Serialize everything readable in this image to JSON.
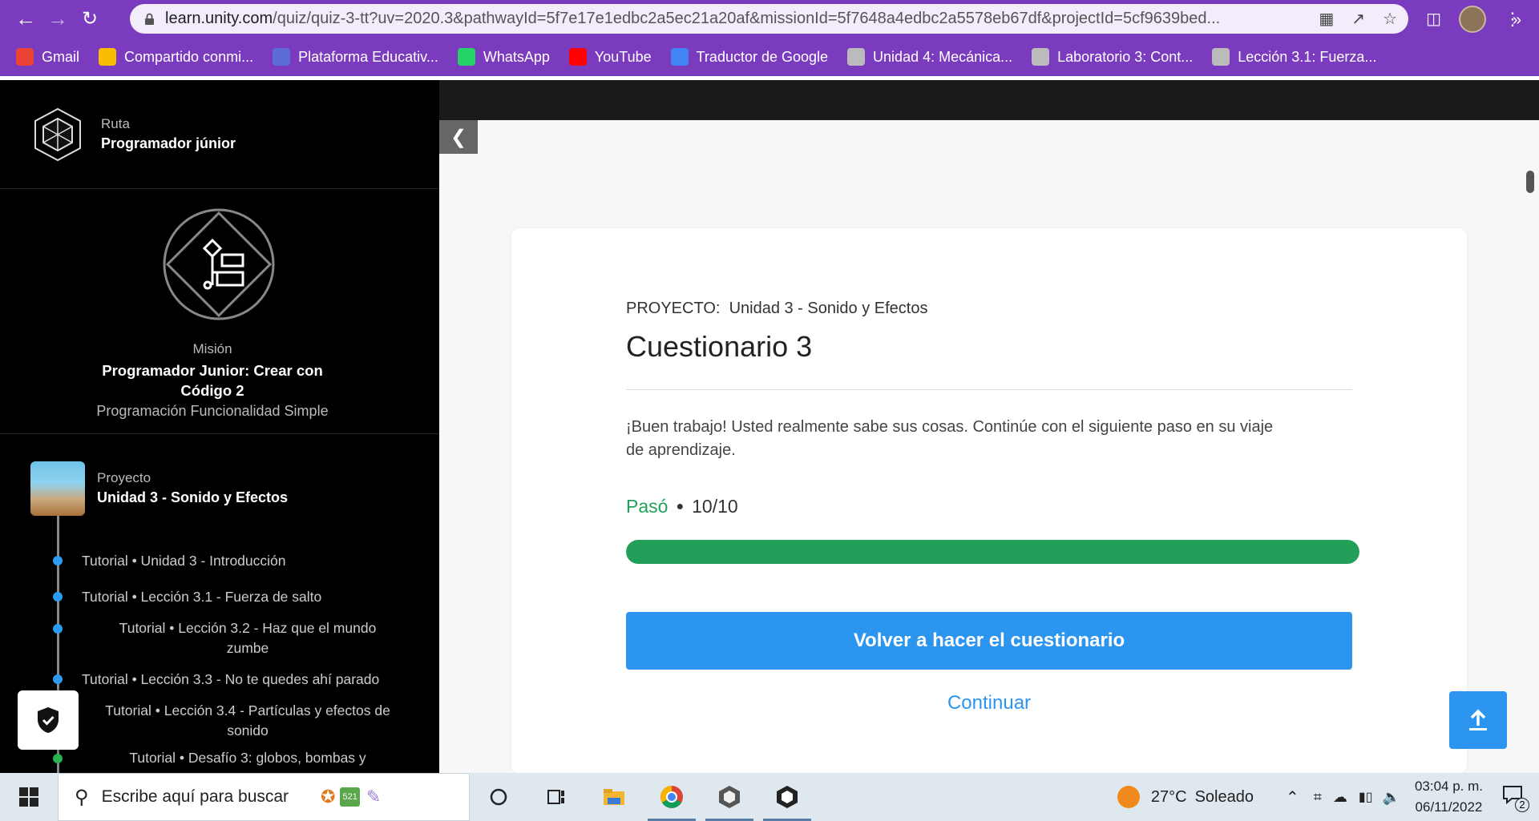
{
  "browser": {
    "url_host": "learn.unity.com",
    "url_path": "/quiz/quiz-3-tt?uv=2020.3&pathwayId=5f7e17e1edbc2a5ec21a20af&missionId=5f7648a4edbc2a5578eb67df&projectId=5cf9639bed...",
    "bookmarks": [
      {
        "label": "Gmail",
        "icon": "gmail-icon",
        "color": "#ea4335"
      },
      {
        "label": "Compartido conmi...",
        "icon": "drive-icon",
        "color": "#fbbc04"
      },
      {
        "label": "Plataforma Educativ...",
        "icon": "platform-icon",
        "color": "#5b6cd9"
      },
      {
        "label": "WhatsApp",
        "icon": "whatsapp-icon",
        "color": "#25d366"
      },
      {
        "label": "YouTube",
        "icon": "youtube-icon",
        "color": "#ff0000"
      },
      {
        "label": "Traductor de Google",
        "icon": "translate-icon",
        "color": "#4285f4"
      },
      {
        "label": "Unidad 4: Mecánica...",
        "icon": "unity-icon",
        "color": "#bbb"
      },
      {
        "label": "Laboratorio 3: Cont...",
        "icon": "unity-icon",
        "color": "#bbb"
      },
      {
        "label": "Lección 3.1: Fuerza...",
        "icon": "unity-icon",
        "color": "#bbb"
      }
    ],
    "more": "»"
  },
  "sidebar": {
    "path_label": "Ruta",
    "path_name": "Programador júnior",
    "mission_label": "Misión",
    "mission_name_1": "Programador Junior: Crear con",
    "mission_name_2": "Código 2",
    "mission_sub": "Programación Funcionalidad Simple",
    "project_label": "Proyecto",
    "project_name": "Unidad 3 - Sonido y Efectos",
    "tutorials": [
      {
        "line1": "Tutorial • Unidad 3 - Introducción",
        "line2": ""
      },
      {
        "line1": "Tutorial • Lección 3.1 - Fuerza de salto",
        "line2": ""
      },
      {
        "line1": "Tutorial • Lección 3.2 - Haz que el mundo",
        "line2": "zumbe"
      },
      {
        "line1": "Tutorial • Lección 3.3 - No te quedes ahí parado",
        "line2": ""
      },
      {
        "line1": "Tutorial • Lección 3.4 - Partículas y efectos de",
        "line2": "sonido"
      },
      {
        "line1": "Tutorial • Desafío 3: globos, bombas y",
        "line2": ""
      }
    ]
  },
  "quiz": {
    "project_prefix": "PROYECTO:",
    "project_name": "Unidad 3 - Sonido y Efectos",
    "title": "Cuestionario 3",
    "message_1": "¡Buen trabajo! Usted realmente sabe sus cosas. Continúe con el siguiente paso en su viaje",
    "message_2": "de aprendizaje.",
    "status": "Pasó",
    "score": "10/10",
    "progress": 1.0,
    "retry_label": "Volver a hacer el cuestionario",
    "continue_label": "Continuar",
    "colors": {
      "pass": "#22a05a",
      "primary": "#2b95f0"
    }
  },
  "taskbar": {
    "search_placeholder": "Escribe aquí para buscar",
    "weather_temp": "27°C",
    "weather_desc": "Soleado",
    "time": "03:04 p. m.",
    "date": "06/11/2022",
    "notif_count": "2",
    "badge_num": "521"
  }
}
